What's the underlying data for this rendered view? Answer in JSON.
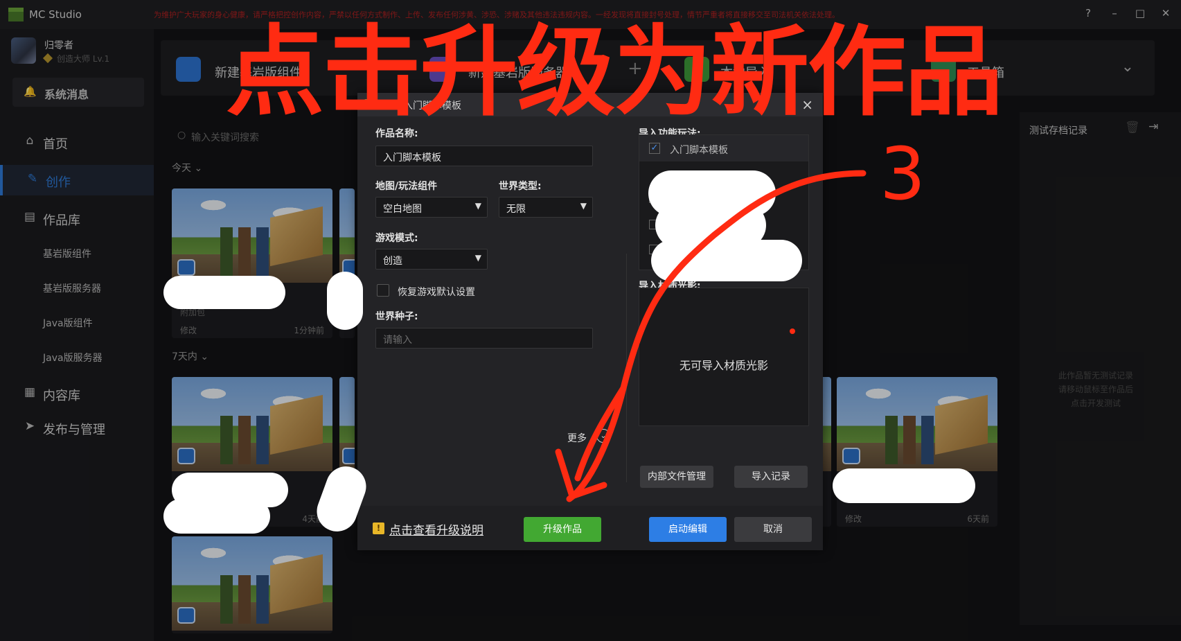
{
  "app": {
    "title": "MC Studio",
    "notice": "为维护广大玩家的身心健康，请严格把控创作内容，严禁以任何方式制作、上传、发布任何涉黄、涉恐、涉赌及其他违法违规内容。一经发现将直接封号处理，情节严重者将直接移交至司法机关依法处理。",
    "window_buttons": [
      "?",
      "–",
      "□",
      "✕"
    ]
  },
  "user": {
    "name": "归零者",
    "level": "创造大师 Lv.1"
  },
  "sidebar": {
    "system_message": "系统消息",
    "items": [
      {
        "label": "首页",
        "icon": "home-icon"
      },
      {
        "label": "创作",
        "icon": "pencil-icon"
      },
      {
        "label": "作品库",
        "icon": "library-icon"
      },
      {
        "label": "内容库",
        "icon": "grid-icon"
      },
      {
        "label": "发布与管理",
        "icon": "send-icon"
      }
    ],
    "sub_items": [
      "基岩版组件",
      "基岩版服务器",
      "Java版组件",
      "Java版服务器"
    ]
  },
  "toolbar": {
    "items": [
      "新建基岩版组件",
      "新建基岩版服务器",
      "本地导入",
      "工具箱"
    ]
  },
  "search": {
    "placeholder": "输入关键词搜索"
  },
  "sections": {
    "today": "今天",
    "week": "7天内"
  },
  "cards": {
    "pack_label": "附加包",
    "modified": "修改",
    "time_1min": "1分钟前",
    "time_4days": "4天前",
    "time_6days": "6天前"
  },
  "test_panel": {
    "title": "测试存档记录",
    "empty_text": [
      "此作品暂无测试记录",
      "请移动鼠标至作品后",
      "点击开发测试"
    ]
  },
  "modal": {
    "title": "新建入门脚本模板",
    "fields": {
      "name_label": "作品名称:",
      "name_value": "入门脚本模板",
      "map_label": "地图/玩法组件",
      "map_value": "空白地图",
      "world_type_label": "世界类型:",
      "world_type_value": "无限",
      "game_mode_label": "游戏模式:",
      "game_mode_value": "创造",
      "restore_label": "恢复游戏默认设置",
      "seed_label": "世界种子:",
      "seed_placeholder": "请输入",
      "more": "更多"
    },
    "import_features_label": "导入功能玩法:",
    "import_features": [
      "入门脚本模板"
    ],
    "import_shader_label": "导入材质光影:",
    "no_shader": "无可导入材质光影",
    "internal_files_button": "内部文件管理",
    "import_history_button": "导入记录",
    "upgrade_info_link": "点击查看升级说明",
    "upgrade_button": "升级作品",
    "launch_button": "启动编辑",
    "cancel_button": "取消"
  },
  "annotation": {
    "headline": "点击升级为新作品",
    "step": "3",
    "color": "#ff2b12"
  }
}
